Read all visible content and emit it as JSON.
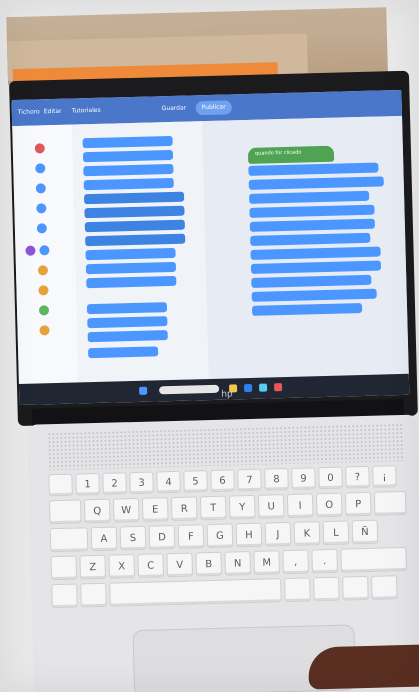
{
  "scene": {
    "description": "",
    "device": "laptop"
  },
  "screen": {
    "tabs": [
      {
        "label": "Tichoro"
      },
      {
        "label": "Editar"
      },
      {
        "label": "Tutoriales"
      }
    ],
    "mode_buttons": [
      {
        "label": "Guardar"
      },
      {
        "label": "Publicar"
      }
    ],
    "workspace_hat_label": "quando",
    "workspace_hat_suffix": "for clicado"
  },
  "laptop": {
    "logo": "hp"
  },
  "keyboard": {
    "row1": [
      "1",
      "2",
      "3",
      "4",
      "5",
      "6",
      "7",
      "8",
      "9",
      "0",
      "?",
      "¡"
    ],
    "row2": [
      "Q",
      "W",
      "E",
      "R",
      "T",
      "Y",
      "U",
      "I",
      "O",
      "P"
    ],
    "row3": [
      "A",
      "S",
      "D",
      "F",
      "G",
      "H",
      "J",
      "K",
      "L",
      "Ñ"
    ],
    "row4": [
      "Z",
      "X",
      "C",
      "V",
      "B",
      "N",
      "M",
      ",",
      "."
    ],
    "space": ""
  },
  "colors": {
    "screen_blue": "#4c97ff",
    "hat_green": "#4fa352",
    "tabbar": "#4a77c9"
  }
}
